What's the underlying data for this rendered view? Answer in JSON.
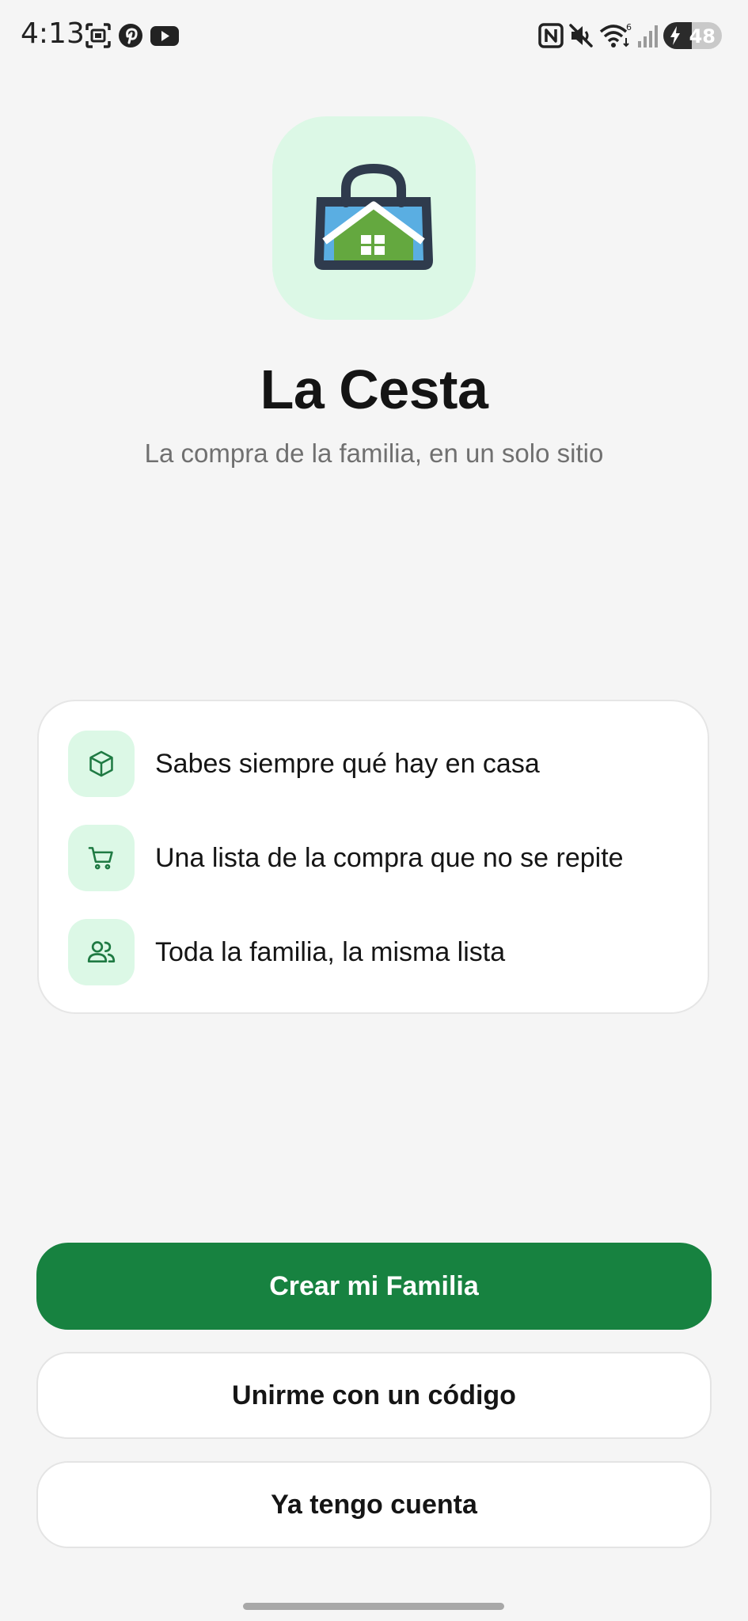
{
  "status_bar": {
    "time": "4:13",
    "battery_percent": "48",
    "battery_level": 0.48,
    "left_icons": [
      "screenshot-icon",
      "pinterest-icon",
      "youtube-icon"
    ],
    "right_icons": [
      "nfc-icon",
      "mute-icon",
      "wifi-icon",
      "signal-icon",
      "battery-icon"
    ]
  },
  "app": {
    "title": "La Cesta",
    "subtitle": "La compra de la familia, en un solo sitio",
    "logo_icon": "shopping-bag-house-icon"
  },
  "features": [
    {
      "icon": "box-icon",
      "text": "Sabes siempre qué hay en casa"
    },
    {
      "icon": "cart-icon",
      "text": "Una lista de la compra que no se repite"
    },
    {
      "icon": "users-icon",
      "text": "Toda la familia, la misma lista"
    }
  ],
  "buttons": {
    "create_family": "Crear mi Familia",
    "join_with_code": "Unirme con un código",
    "have_account": "Ya tengo cuenta"
  },
  "colors": {
    "primary": "#178240",
    "accent_light": "#dcf8e6",
    "background": "#f5f5f5",
    "icon_stroke": "#1f7a43"
  }
}
